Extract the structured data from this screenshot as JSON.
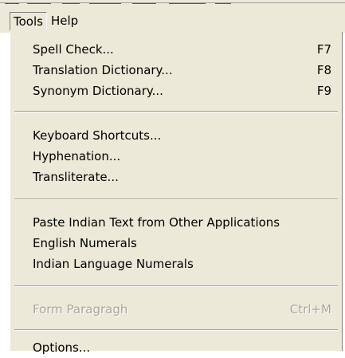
{
  "menubar": {
    "menus": [
      {
        "label": "Tools",
        "open": true
      },
      {
        "label": "Help",
        "open": false
      }
    ]
  },
  "tools_menu": {
    "groups": [
      {
        "items": [
          {
            "label": "Spell Check...",
            "shortcut": "F7",
            "enabled": true
          },
          {
            "label": "Translation Dictionary...",
            "shortcut": "F8",
            "enabled": true
          },
          {
            "label": "Synonym Dictionary...",
            "shortcut": "F9",
            "enabled": true
          }
        ]
      },
      {
        "items": [
          {
            "label": "Keyboard Shortcuts...",
            "shortcut": "",
            "enabled": true
          },
          {
            "label": "Hyphenation...",
            "shortcut": "",
            "enabled": true
          },
          {
            "label": "Transliterate...",
            "shortcut": "",
            "enabled": true
          }
        ]
      },
      {
        "items": [
          {
            "label": "Paste Indian Text from Other Applications",
            "shortcut": "",
            "enabled": true
          },
          {
            "label": "English Numerals",
            "shortcut": "",
            "enabled": true
          },
          {
            "label": "Indian Language Numerals",
            "shortcut": "",
            "enabled": true
          }
        ]
      },
      {
        "items": [
          {
            "label": "Form Paragragh",
            "shortcut": "Ctrl+M",
            "enabled": false
          }
        ]
      },
      {
        "items": [
          {
            "label": "Options...",
            "shortcut": "",
            "enabled": true
          }
        ]
      }
    ]
  },
  "colors": {
    "menu_background": "#ece9d8",
    "disabled_text": "#a7a69c",
    "separator_dark": "#9d9d92"
  }
}
